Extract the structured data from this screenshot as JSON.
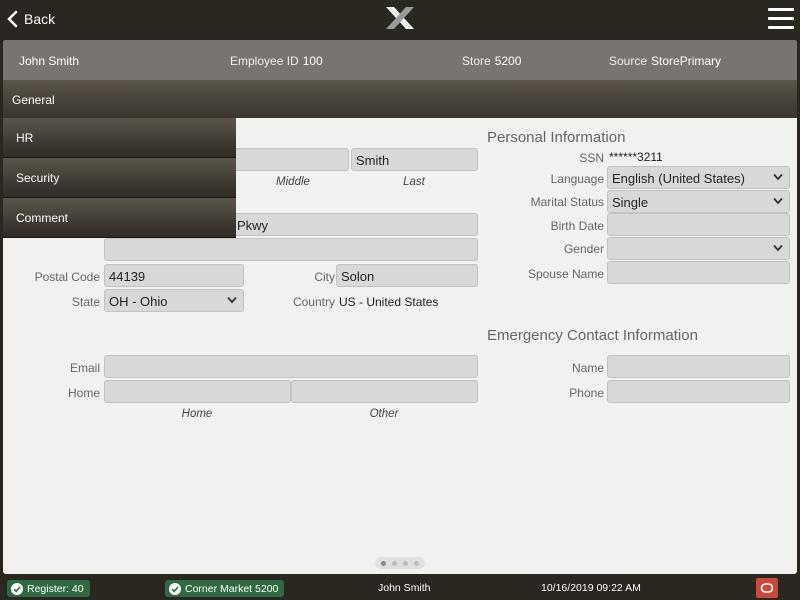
{
  "topbar": {
    "back_label": "Back",
    "logo_icon": "x-logo-icon",
    "menu_icon": "hamburger-icon"
  },
  "header": {
    "name": "John Smith",
    "employee_id_label": "Employee ID",
    "employee_id": "100",
    "store_label": "Store",
    "store": "5200",
    "source_label": "Source",
    "source": "StorePrimary"
  },
  "tabs": {
    "general": "General",
    "items": [
      "HR",
      "Security",
      "Comment"
    ]
  },
  "name_section": {
    "middle_label": "Middle",
    "last_label": "Last",
    "last_value": "Smith"
  },
  "address": {
    "line1_value": "Pkwy",
    "line2_value": "",
    "postal_label": "Postal Code",
    "postal_value": "44139",
    "city_label": "City",
    "city_value": "Solon",
    "state_label": "State",
    "state_value": "OH - Ohio",
    "country_label": "Country",
    "country_value": "US - United States"
  },
  "contact": {
    "email_label": "Email",
    "email_value": "",
    "home_label": "Home",
    "home_sub": "Home",
    "other_sub": "Other"
  },
  "personal": {
    "title": "Personal Information",
    "ssn_label": "SSN",
    "ssn_value": "******3211",
    "language_label": "Language",
    "language_value": "English (United States)",
    "marital_label": "Marital Status",
    "marital_value": "Single",
    "birth_label": "Birth Date",
    "birth_value": "",
    "gender_label": "Gender",
    "gender_value": "",
    "spouse_label": "Spouse Name",
    "spouse_value": ""
  },
  "emergency": {
    "title": "Emergency Contact Information",
    "name_label": "Name",
    "name_value": "",
    "phone_label": "Phone",
    "phone_value": ""
  },
  "pager": {
    "pages": 4,
    "current": 1
  },
  "statusbar": {
    "register": "Register: 40",
    "store": "Corner Market 5200",
    "user": "John Smith",
    "datetime": "10/16/2019 09:22 AM"
  },
  "colors": {
    "accent_green": "#2f6a42",
    "power_red": "#c84a3a",
    "bar_dark": "#2a2620"
  }
}
